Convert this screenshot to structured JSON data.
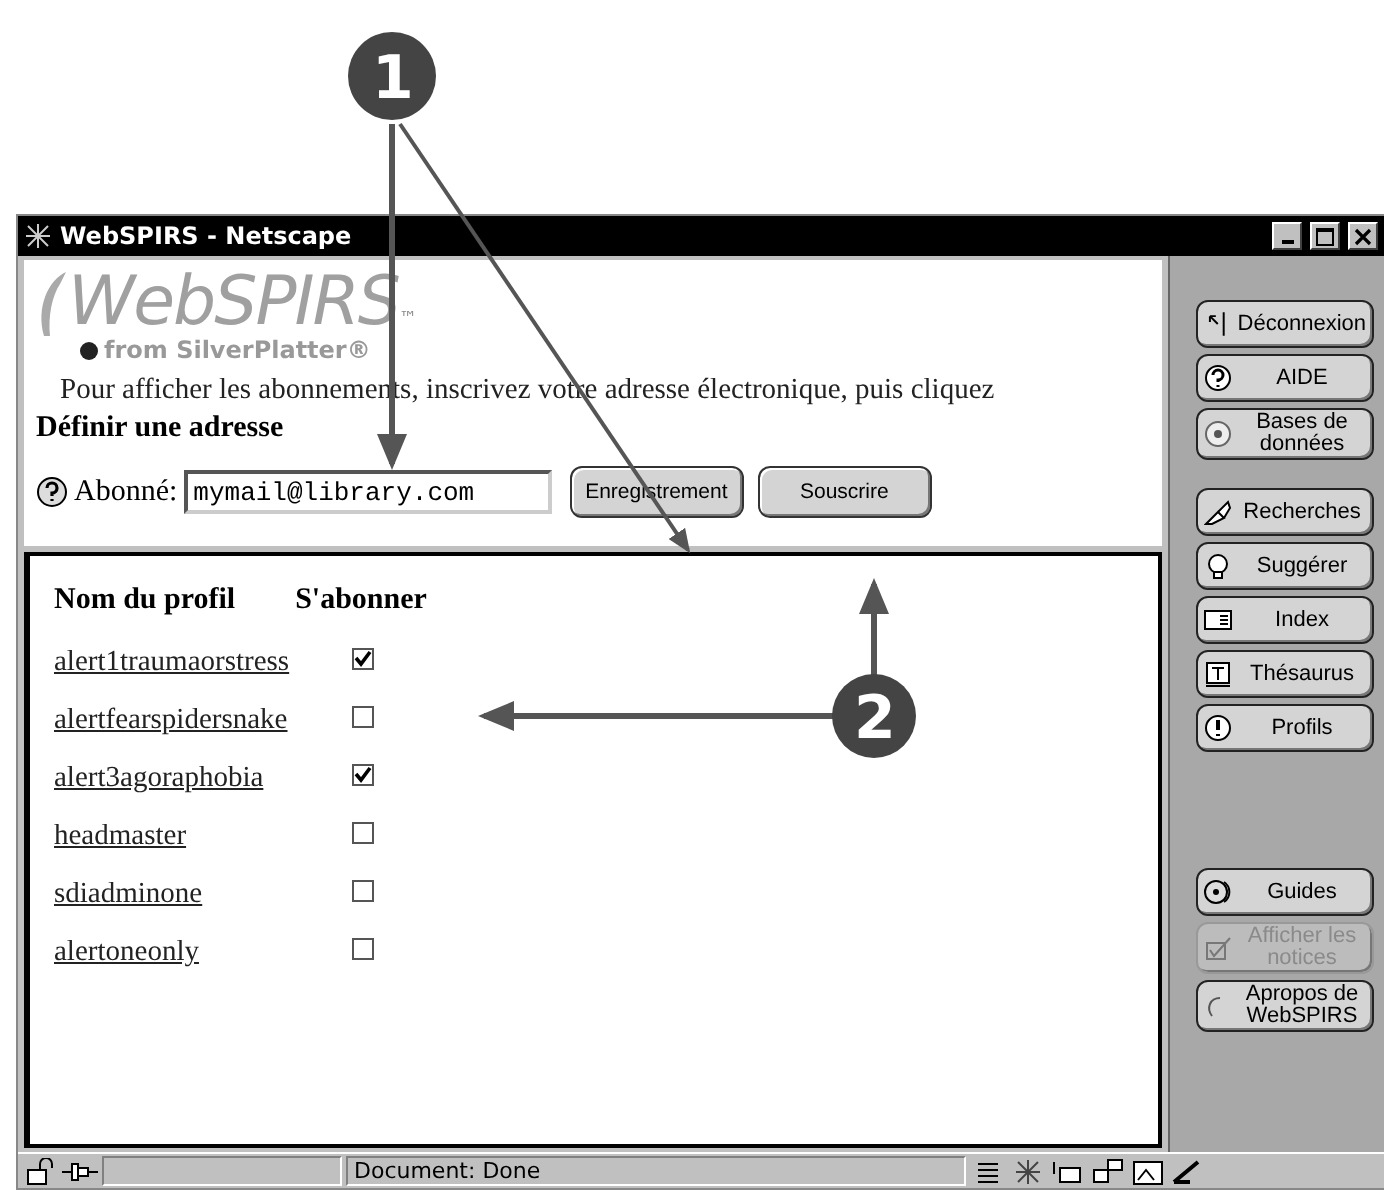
{
  "callouts": [
    {
      "number": "1"
    },
    {
      "number": "2"
    }
  ],
  "window": {
    "title": "WebSPIRS - Netscape"
  },
  "logo": {
    "name": "WebSPIRS",
    "trademark": "™",
    "tagline": "from SilverPlatter®"
  },
  "intro": "Pour afficher les abonnements, inscrivez votre adresse électronique, puis cliquez",
  "section_title": "Définir une adresse",
  "subscriber": {
    "label": "Abonné:",
    "value": "mymail@library.com"
  },
  "buttons": [
    "Enregistrement",
    "Souscrire"
  ],
  "table": {
    "columns": [
      "Nom du profil",
      "S'abonner"
    ],
    "rows": [
      {
        "name": "alert1traumaorstress",
        "checked": true
      },
      {
        "name": "alertfearspidersnake",
        "checked": false
      },
      {
        "name": "alert3agoraphobia",
        "checked": true
      },
      {
        "name": "headmaster",
        "checked": false
      },
      {
        "name": "sdiadminone",
        "checked": false
      },
      {
        "name": "alertoneonly",
        "checked": false
      }
    ]
  },
  "sidebar": {
    "groups": [
      [
        {
          "label": "Déconnexion",
          "disabled": false
        },
        {
          "label": "AIDE",
          "disabled": false
        },
        {
          "label": "Bases de données",
          "disabled": false
        }
      ],
      [
        {
          "label": "Recherches",
          "disabled": false
        },
        {
          "label": "Suggérer",
          "disabled": false
        },
        {
          "label": "Index",
          "disabled": false
        },
        {
          "label": "Thésaurus",
          "disabled": false
        },
        {
          "label": "Profils",
          "disabled": false
        }
      ],
      [
        {
          "label": "Guides",
          "disabled": false
        },
        {
          "label": "Afficher les notices",
          "disabled": true
        },
        {
          "label": "Apropos de WebSPIRS",
          "disabled": false
        }
      ]
    ]
  },
  "status_bar": {
    "text": "Document: Done"
  }
}
